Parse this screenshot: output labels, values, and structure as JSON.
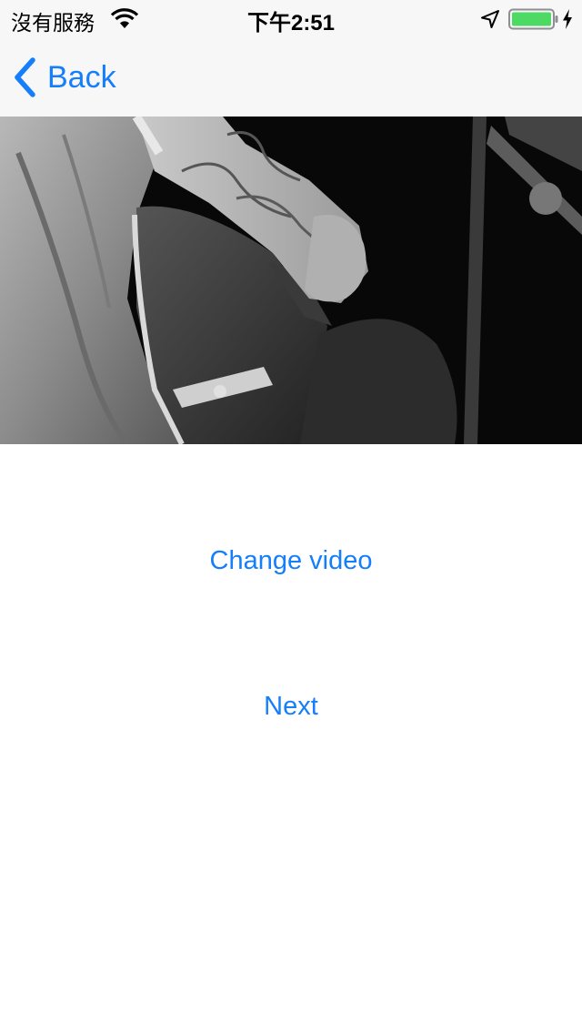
{
  "status_bar": {
    "carrier": "沒有服務",
    "time": "下午2:51",
    "battery_color": "#4cd964"
  },
  "nav": {
    "back_label": "Back",
    "accent_color": "#157efb"
  },
  "video": {
    "description_icon": "video-frame"
  },
  "buttons": {
    "change_video": "Change video",
    "next": "Next"
  }
}
